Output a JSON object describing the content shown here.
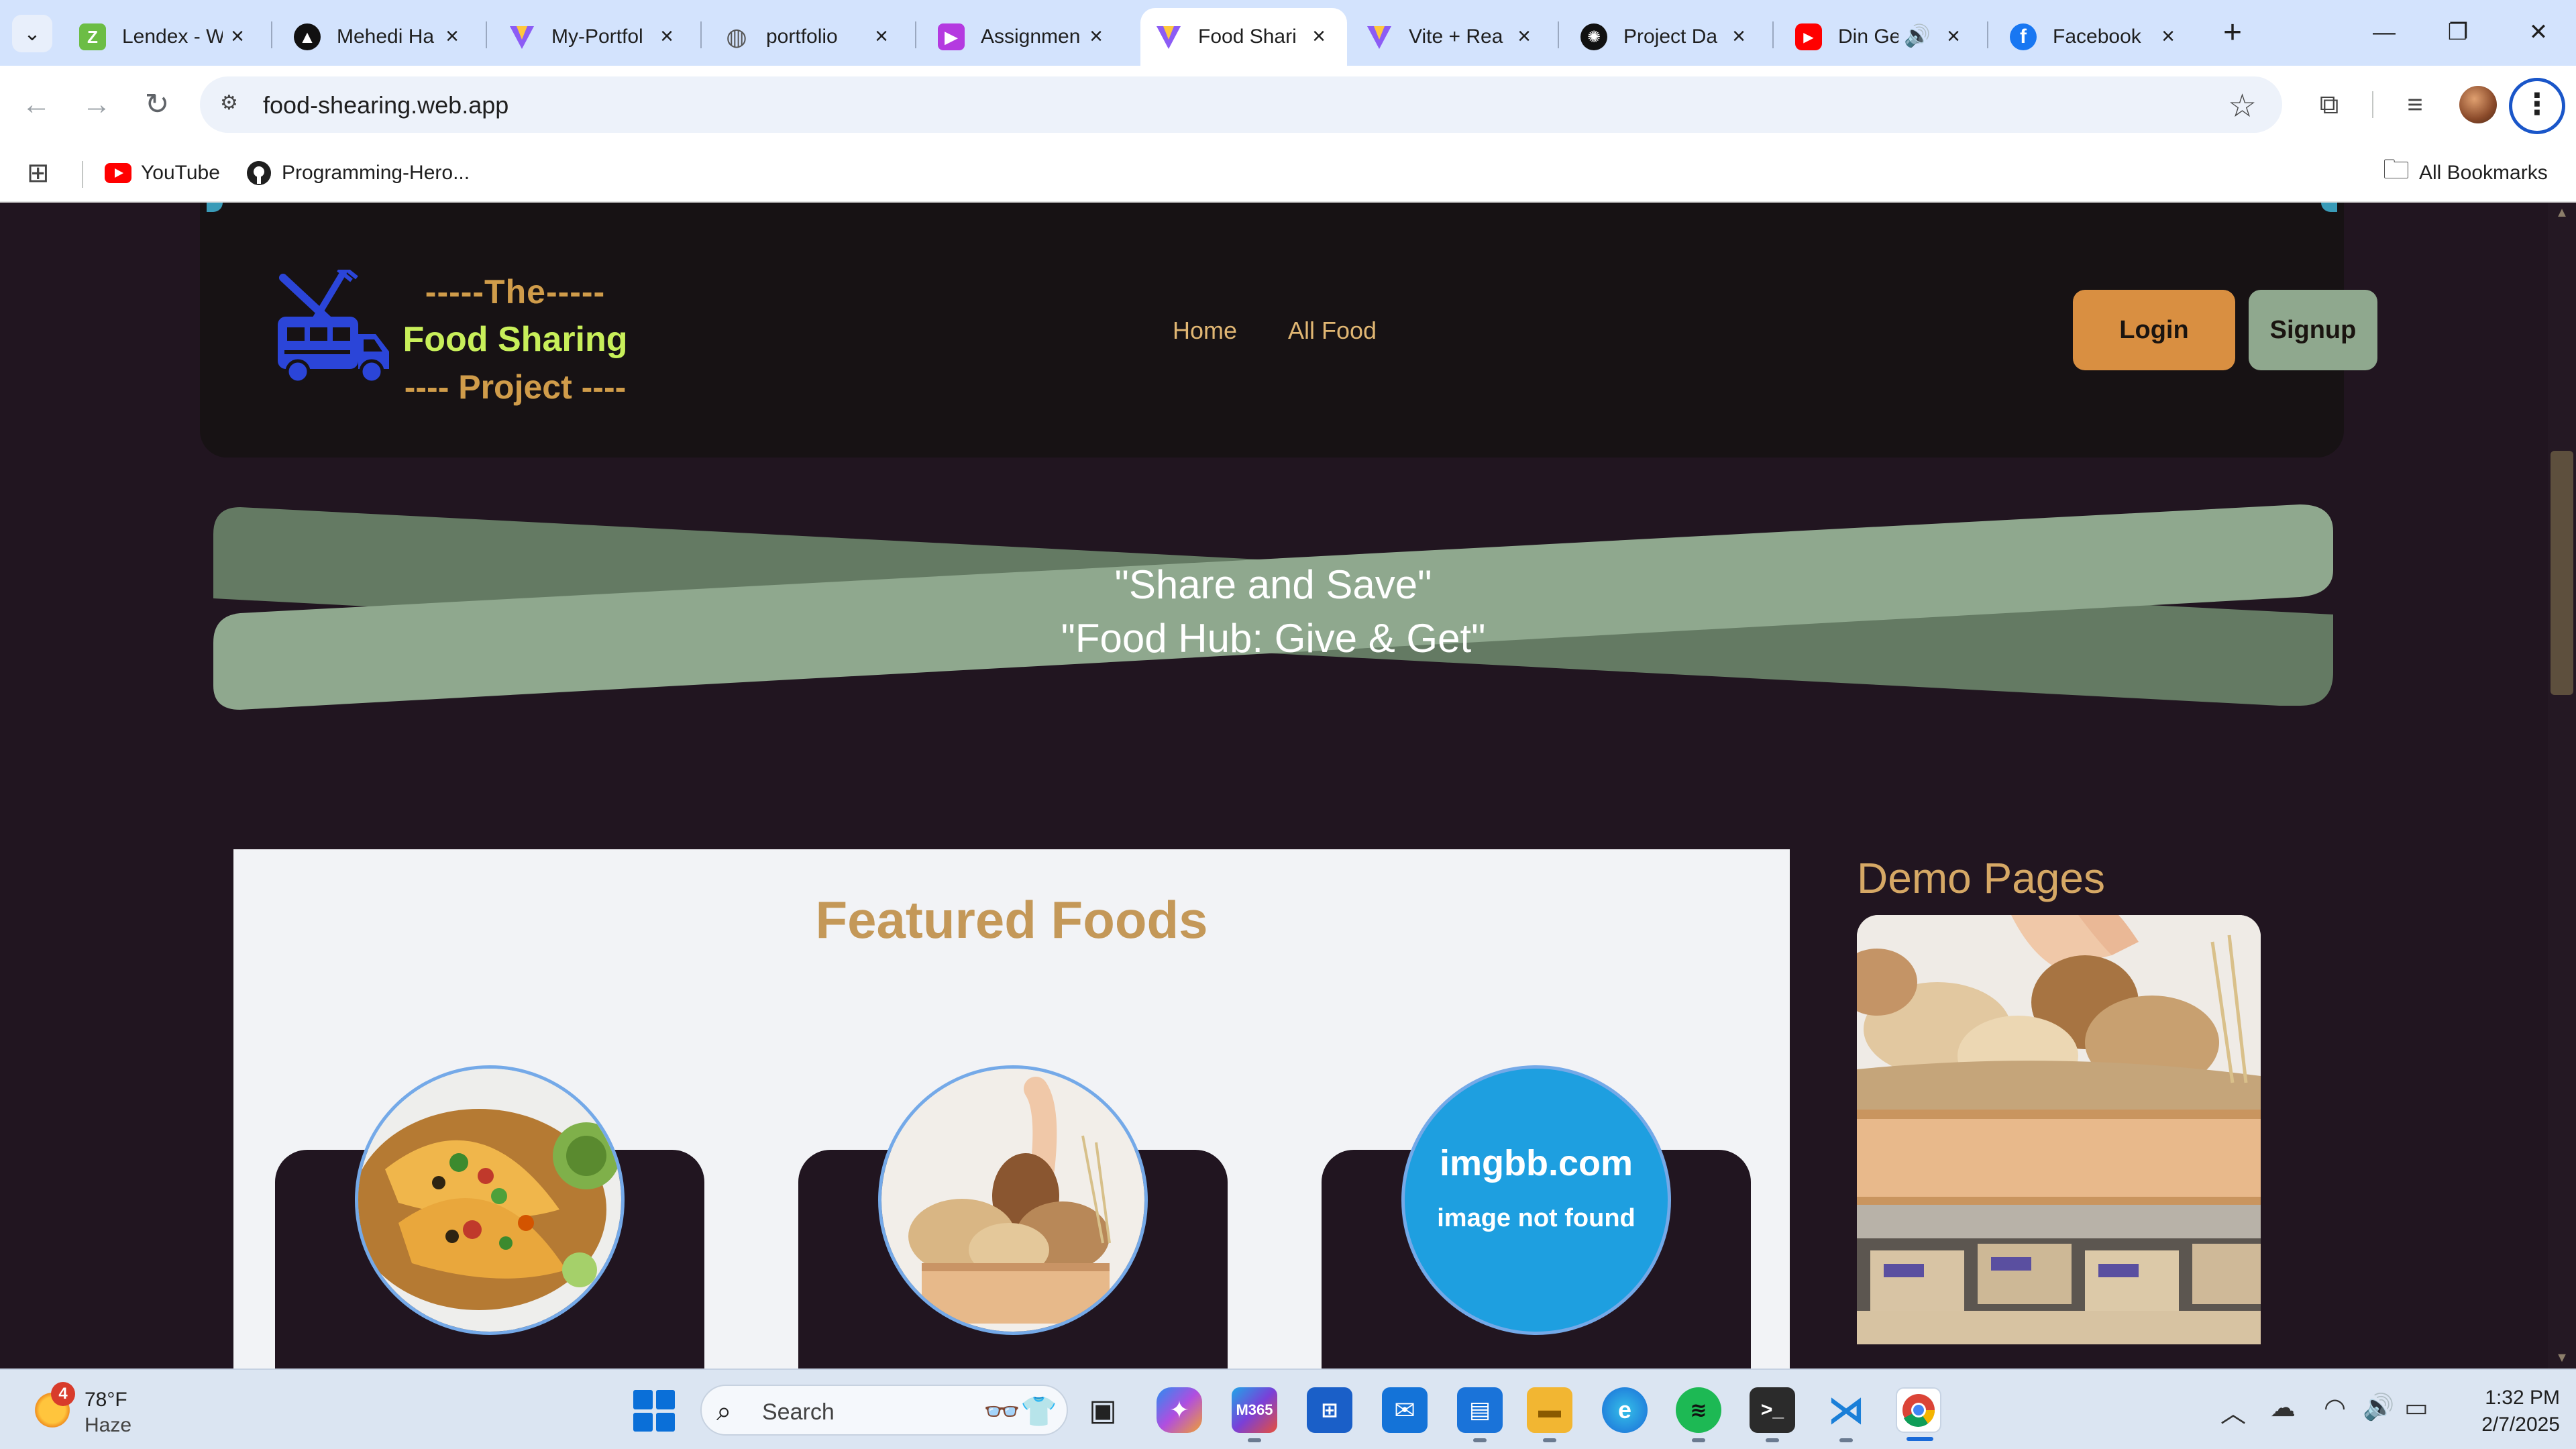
{
  "browser": {
    "tabs": [
      {
        "title": "Lendex - W",
        "icon": "lendex-icon",
        "color": "#6cbd45"
      },
      {
        "title": "Mehedi Ha",
        "icon": "vercel-icon",
        "color": "#111111"
      },
      {
        "title": "My-Portfol",
        "icon": "vite-icon",
        "color": "#8c5cf5"
      },
      {
        "title": "portfolio",
        "icon": "globe-icon",
        "color": "#555555"
      },
      {
        "title": "Assignmen",
        "icon": "assignment-icon",
        "color": "#b43ae0"
      },
      {
        "title": "Food Shari",
        "icon": "vite-icon",
        "color": "#8c5cf5",
        "active": true
      },
      {
        "title": "Vite + Rea",
        "icon": "vite-icon",
        "color": "#8c5cf5"
      },
      {
        "title": "Project Da",
        "icon": "openai-icon",
        "color": "#111111"
      },
      {
        "title": "Din Ge",
        "icon": "youtube-icon",
        "color": "#ff0000",
        "audio": true
      },
      {
        "title": "Facebook",
        "icon": "facebook-icon",
        "color": "#1877f2"
      }
    ],
    "url": "food-shearing.web.app",
    "bookmarks": [
      {
        "label": "YouTube",
        "icon": "youtube-icon"
      },
      {
        "label": "Programming-Hero...",
        "icon": "github-icon"
      }
    ],
    "all_bookmarks": "All Bookmarks"
  },
  "site": {
    "logo": {
      "line1": "-----The-----",
      "line2": "Food Sharing",
      "line3": "---- Project ----"
    },
    "nav": {
      "home": "Home",
      "all_food": "All Food"
    },
    "buttons": {
      "login": "Login",
      "signup": "Signup"
    },
    "banner": {
      "line1": "\"Share and Save\"",
      "line2": "\"Food Hub: Give & Get\""
    },
    "featured": {
      "title": "Featured Foods",
      "placeholder": {
        "line1": "imgbb.com",
        "line2": "image not found"
      }
    },
    "demo": {
      "title": "Demo Pages"
    }
  },
  "taskbar": {
    "weather": {
      "temp": "78°F",
      "condition": "Haze",
      "badge": "4"
    },
    "search": "Search",
    "clock": {
      "time": "1:32 PM",
      "date": "2/7/2025"
    }
  },
  "colors": {
    "page_bg": "#211520",
    "nav_bg": "#171214",
    "accent_gold": "#d09c4a",
    "logo_green": "#c8ef5a",
    "login": "#d98f41",
    "signup": "#8fa88e",
    "banner_light": "#8fa88e",
    "banner_dark": "#647a63"
  }
}
